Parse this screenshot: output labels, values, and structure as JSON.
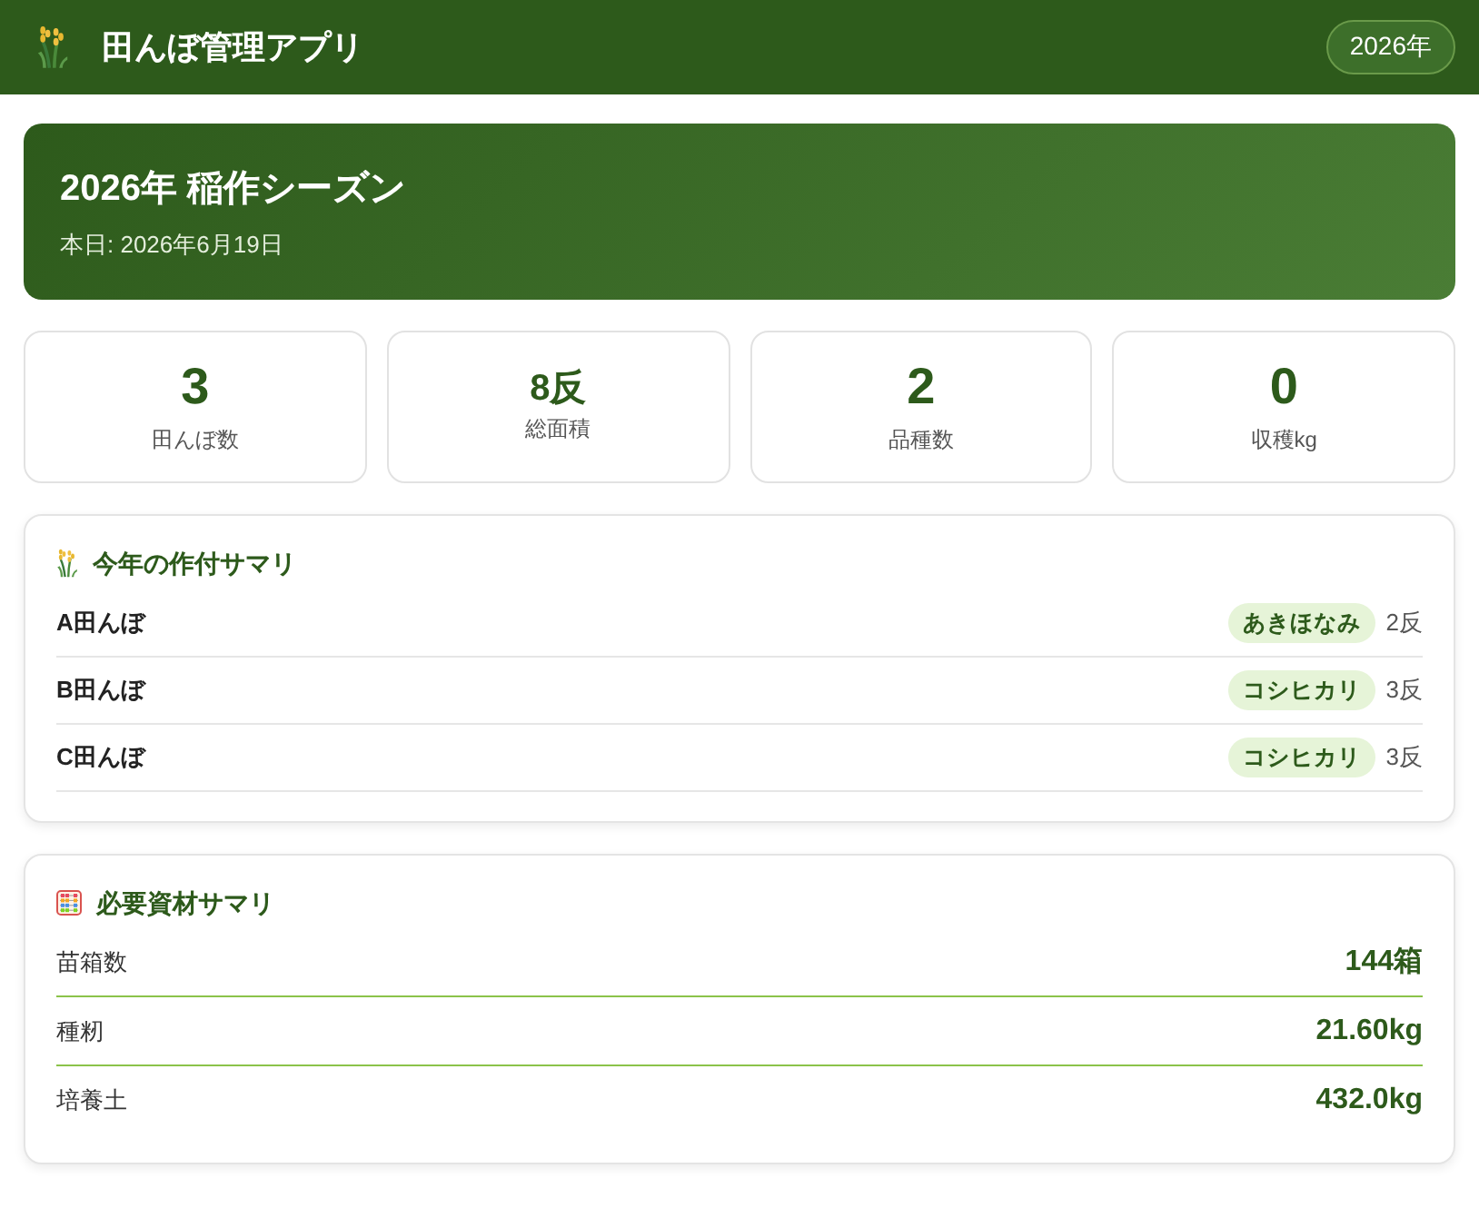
{
  "header": {
    "title": "田んぼ管理アプリ",
    "year_badge": "2026年"
  },
  "season": {
    "title": "2026年 稲作シーズン",
    "date": "本日: 2026年6月19日"
  },
  "stats": [
    {
      "kind": "number",
      "value": "3",
      "label": "田んぼ数"
    },
    {
      "kind": "measure",
      "value": "8反",
      "label": "総面積"
    },
    {
      "kind": "number",
      "value": "2",
      "label": "品種数"
    },
    {
      "kind": "number",
      "value": "0",
      "label": "収穫kg"
    }
  ],
  "crop_summary": {
    "title": "今年の作付サマリ",
    "rows": [
      {
        "field": "A田んぼ",
        "variety": "あきほなみ",
        "area": "2反"
      },
      {
        "field": "B田んぼ",
        "variety": "コシヒカリ",
        "area": "3反"
      },
      {
        "field": "C田んぼ",
        "variety": "コシヒカリ",
        "area": "3反"
      }
    ]
  },
  "materials_summary": {
    "title": "必要資材サマリ",
    "rows": [
      {
        "label": "苗箱数",
        "value": "144箱"
      },
      {
        "label": "種籾",
        "value": "21.60kg"
      },
      {
        "label": "培養土",
        "value": "432.0kg"
      }
    ]
  }
}
